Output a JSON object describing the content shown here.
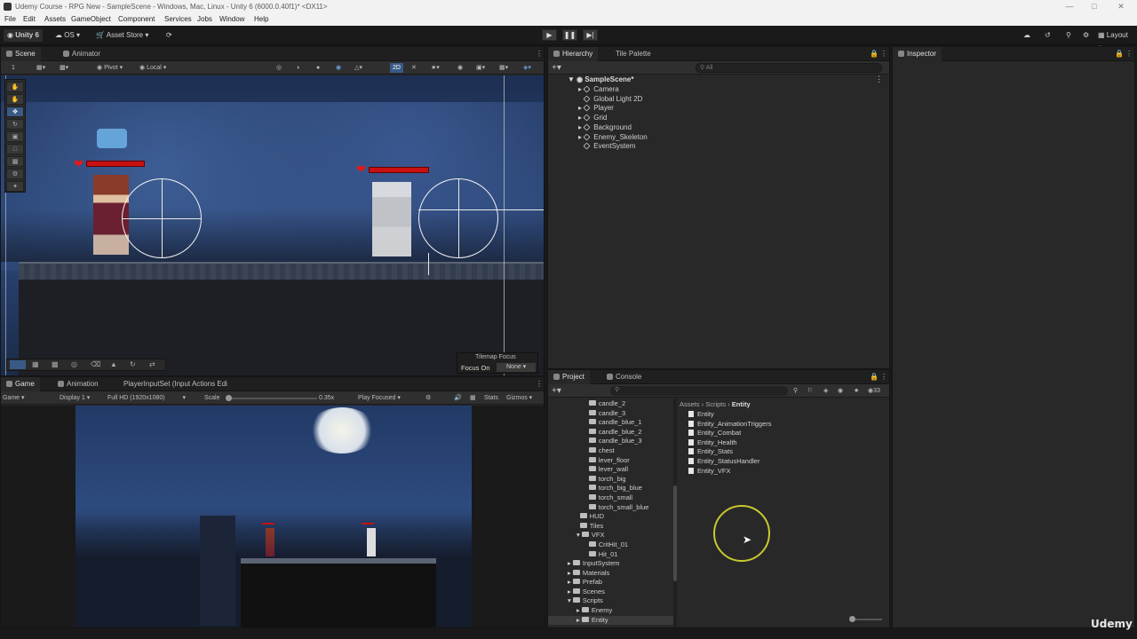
{
  "window": {
    "title": "Udemy Course - RPG New - SampleScene - Windows, Mac, Linux - Unity 6 (6000.0.40f1)* <DX11>"
  },
  "menu": [
    "File",
    "Edit",
    "Assets",
    "GameObject",
    "Component",
    "Services",
    "Jobs",
    "Window",
    "Help"
  ],
  "toolbar": {
    "account": "Unity 6",
    "platform": "OS",
    "asset_store": "Asset Store",
    "layout": "Layout"
  },
  "scene_tabs": {
    "scene": "Scene",
    "animator": "Animator"
  },
  "scene_bar": {
    "layer_num": "1",
    "pivot": "Pivot",
    "local": "Local",
    "mode_2d": "2D"
  },
  "tilemap": {
    "title": "Tilemap Focus",
    "focus_on": "Focus On",
    "focus_value": "None"
  },
  "game_tabs": {
    "game": "Game",
    "animation": "Animation",
    "input": "PlayerInputSet (Input Actions Edi"
  },
  "game_bar": {
    "view": "Game",
    "display": "Display 1",
    "resolution": "Full HD (1920x1080)",
    "scale_label": "Scale",
    "scale_value": "0.35x",
    "play_mode": "Play Focused",
    "stats": "Stats",
    "gizmos": "Gizmos"
  },
  "hierarchy": {
    "tabs": [
      "Hierarchy",
      "Tile Palette"
    ],
    "search_placeholder": "All",
    "scene": "SampleScene*",
    "items": [
      "Camera",
      "Global Light 2D",
      "Player",
      "Grid",
      "Background",
      "Enemy_Skeleton",
      "EventSystem"
    ]
  },
  "inspector": {
    "title": "Inspector"
  },
  "project": {
    "tabs": [
      "Project",
      "Console"
    ],
    "count": "33",
    "breadcrumb": [
      "Assets",
      "Scripts",
      "Entity"
    ],
    "tree": [
      {
        "label": "candle_2",
        "indent": 3
      },
      {
        "label": "candle_3",
        "indent": 3
      },
      {
        "label": "candle_blue_1",
        "indent": 3
      },
      {
        "label": "candle_blue_2",
        "indent": 3
      },
      {
        "label": "candle_blue_3",
        "indent": 3
      },
      {
        "label": "chest",
        "indent": 3
      },
      {
        "label": "lever_floor",
        "indent": 3
      },
      {
        "label": "lever_wall",
        "indent": 3
      },
      {
        "label": "torch_big",
        "indent": 3
      },
      {
        "label": "torch_big_blue",
        "indent": 3
      },
      {
        "label": "torch_small",
        "indent": 3
      },
      {
        "label": "torch_small_blue",
        "indent": 3
      },
      {
        "label": "HUD",
        "indent": 2
      },
      {
        "label": "Tiles",
        "indent": 2
      },
      {
        "label": "VFX",
        "indent": 2
      },
      {
        "label": "CritHit_01",
        "indent": 3
      },
      {
        "label": "Hit_01",
        "indent": 3
      },
      {
        "label": "InputSystem",
        "indent": 1
      },
      {
        "label": "Materials",
        "indent": 1
      },
      {
        "label": "Prefab",
        "indent": 1
      },
      {
        "label": "Scenes",
        "indent": 1
      },
      {
        "label": "Scripts",
        "indent": 1
      },
      {
        "label": "Enemy",
        "indent": 2
      },
      {
        "label": "Entity",
        "indent": 2
      }
    ],
    "files": [
      "Entity",
      "Entity_AnimationTriggers",
      "Entity_Combat",
      "Entity_Health",
      "Entity_Stats",
      "Entity_StatusHandler",
      "Entity_VFX"
    ]
  },
  "watermark": "Udemy",
  "colors": {
    "accent": "#3a79bb",
    "health": "#c81010",
    "cursor_ring": "#c8c830"
  }
}
